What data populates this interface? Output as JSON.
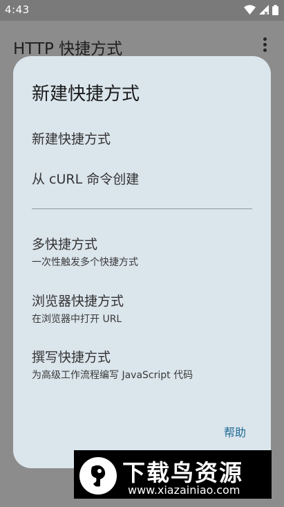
{
  "status_bar": {
    "time": "4:43",
    "icons": [
      "wifi-icon",
      "signal-icon",
      "battery-icon"
    ]
  },
  "app_bar": {
    "title": "HTTP 快捷方式",
    "menu_icon": "more-vert-icon"
  },
  "dialog": {
    "title": "新建快捷方式",
    "top_items": [
      {
        "label": "新建快捷方式"
      },
      {
        "label": "从 cURL 命令创建"
      }
    ],
    "items": [
      {
        "label": "多快捷方式",
        "description": "一次性触发多个快捷方式"
      },
      {
        "label": "浏览器快捷方式",
        "description": "在浏览器中打开 URL"
      },
      {
        "label": "撰写快捷方式",
        "description": "为高级工作流程编写 JavaScript 代码"
      }
    ],
    "help_label": "帮助"
  },
  "watermark": {
    "brand": "下载鸟资源",
    "url": "www.xiazainiao.com"
  },
  "colors": {
    "scrim": "#8c8c8c",
    "dialog_bg": "#dbe5ec",
    "accent": "#1f6a94"
  }
}
